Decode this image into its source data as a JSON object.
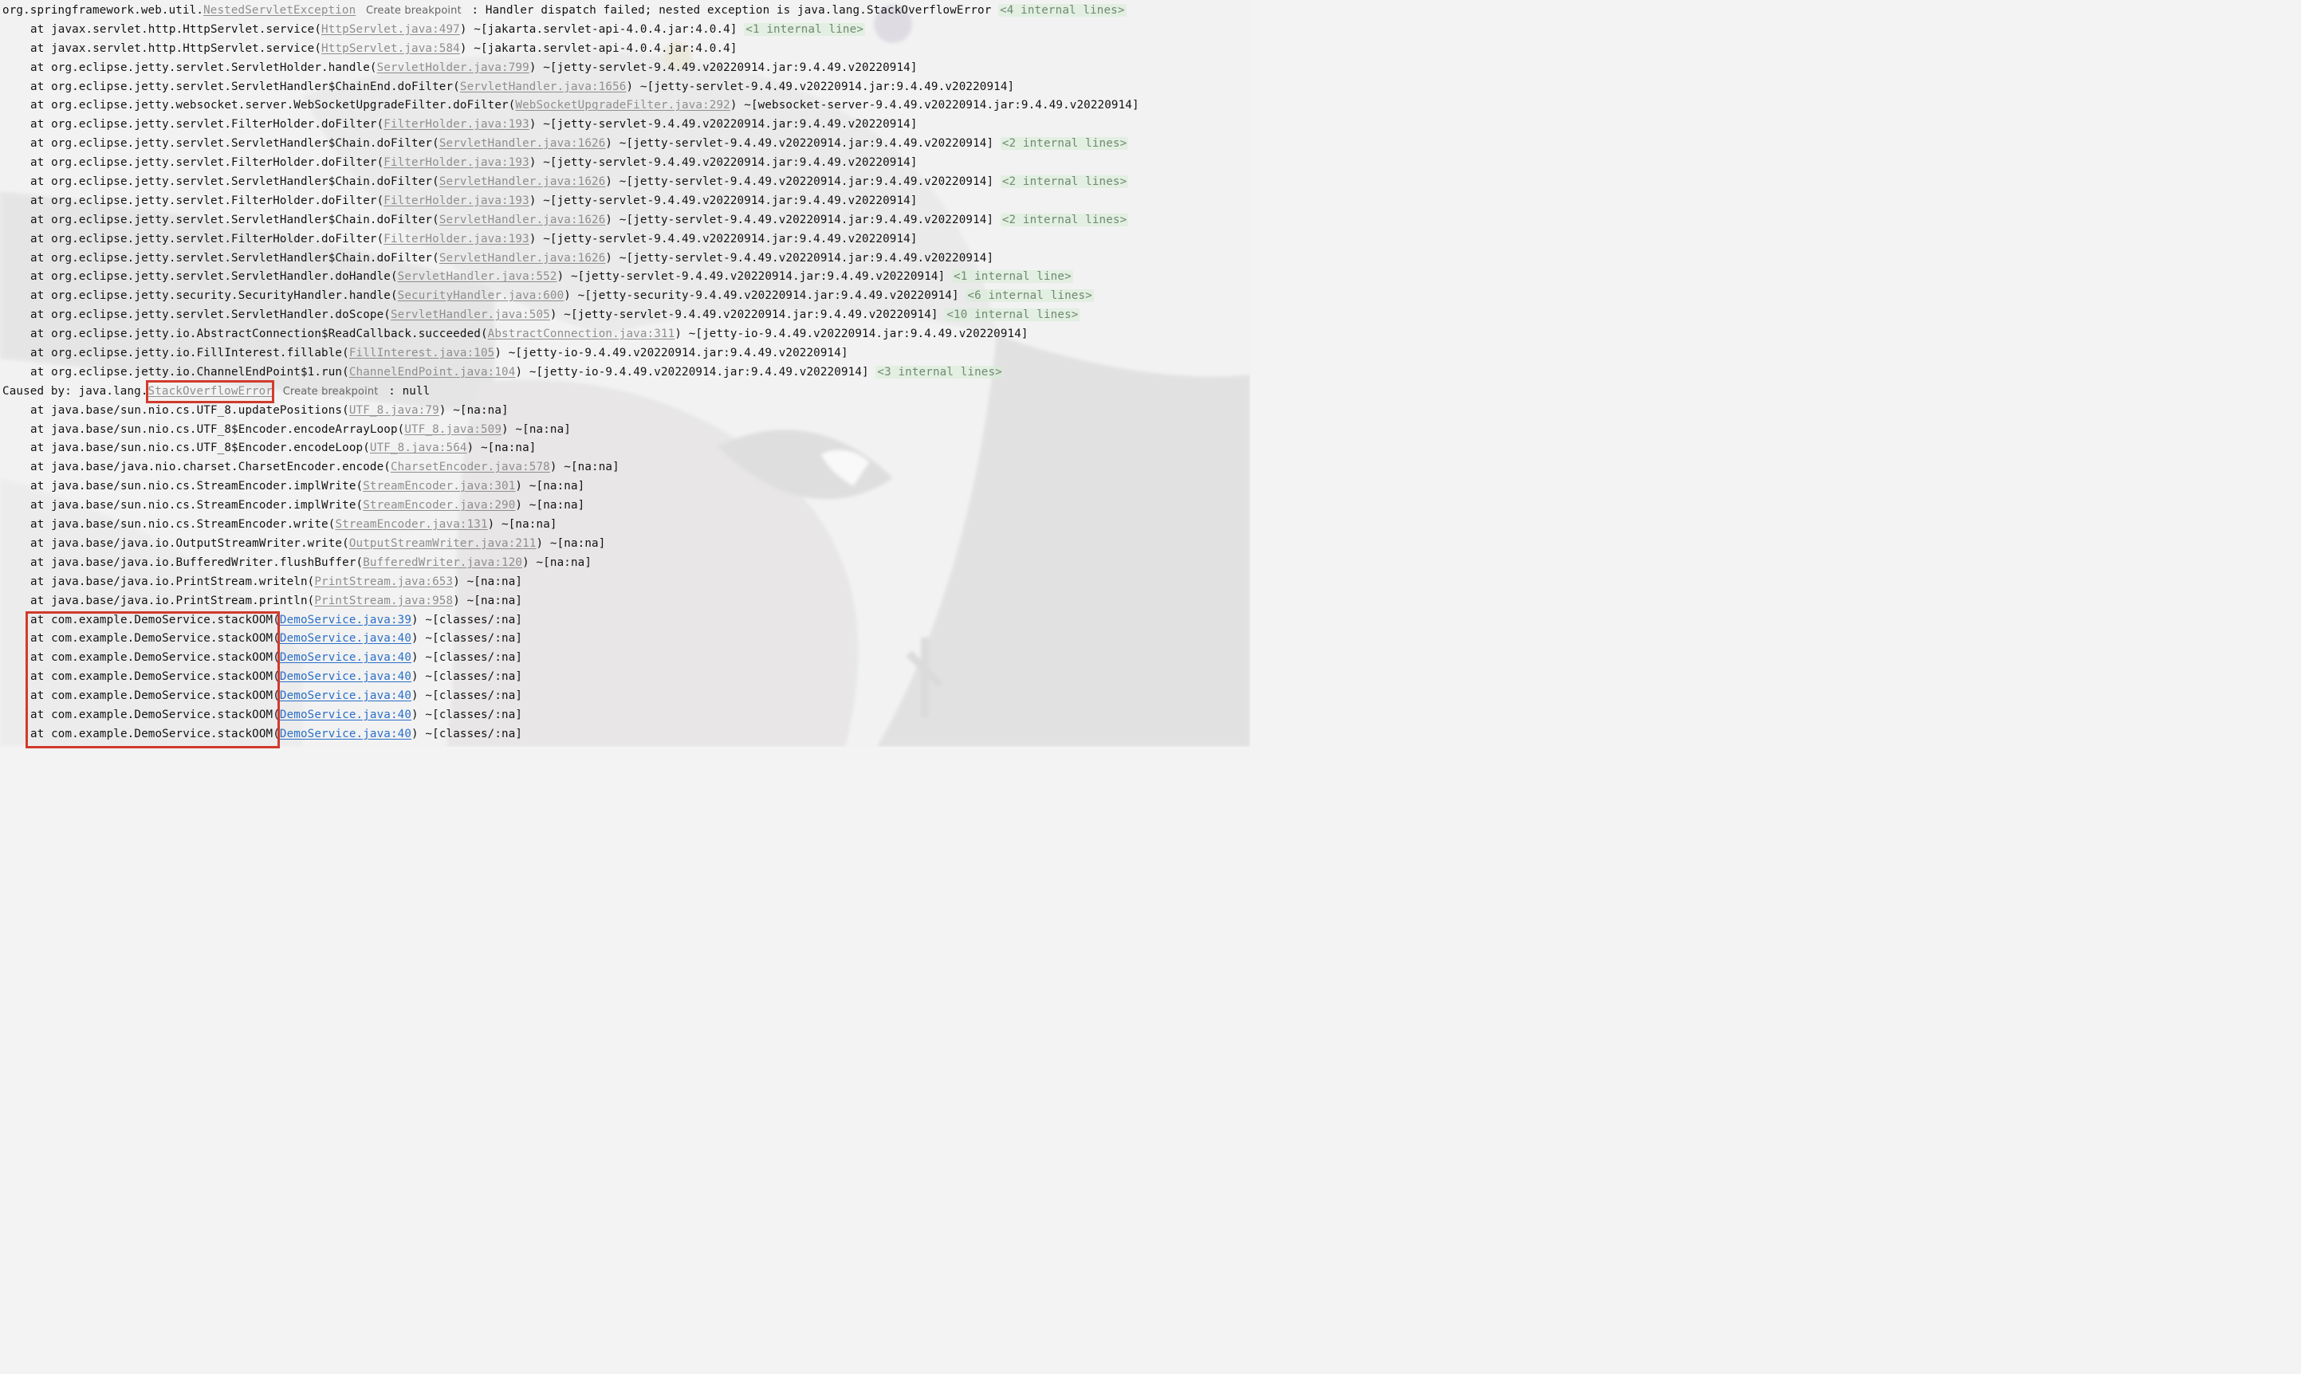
{
  "header": {
    "package": "org.springframework.web.util.",
    "exception_link": "NestedServletException",
    "breakpoint_label": "Create breakpoint",
    "message": " : Handler dispatch failed; nested exception is java.lang.StackOverflowError ",
    "internal": "<4 internal lines>"
  },
  "frames_top": [
    {
      "method": "at javax.servlet.http.HttpServlet.service(",
      "file": "HttpServlet.java:497",
      "jar": ") ~[jakarta.servlet-api-4.0.4.jar:4.0.4] ",
      "internal": "<1 internal line>"
    },
    {
      "method": "at javax.servlet.http.HttpServlet.service(",
      "file": "HttpServlet.java:584",
      "jar": ") ~[jakarta.servlet-api-4.0.4.jar:4.0.4]",
      "internal": ""
    },
    {
      "method": "at org.eclipse.jetty.servlet.ServletHolder.handle(",
      "file": "ServletHolder.java:799",
      "jar": ") ~[jetty-servlet-9.4.49.v20220914.jar:9.4.49.v20220914]",
      "internal": ""
    },
    {
      "method": "at org.eclipse.jetty.servlet.ServletHandler$ChainEnd.doFilter(",
      "file": "ServletHandler.java:1656",
      "jar": ") ~[jetty-servlet-9.4.49.v20220914.jar:9.4.49.v20220914]",
      "internal": ""
    },
    {
      "method": "at org.eclipse.jetty.websocket.server.WebSocketUpgradeFilter.doFilter(",
      "file": "WebSocketUpgradeFilter.java:292",
      "jar": ") ~[websocket-server-9.4.49.v20220914.jar:9.4.49.v20220914]",
      "internal": ""
    },
    {
      "method": "at org.eclipse.jetty.servlet.FilterHolder.doFilter(",
      "file": "FilterHolder.java:193",
      "jar": ") ~[jetty-servlet-9.4.49.v20220914.jar:9.4.49.v20220914]",
      "internal": ""
    },
    {
      "method": "at org.eclipse.jetty.servlet.ServletHandler$Chain.doFilter(",
      "file": "ServletHandler.java:1626",
      "jar": ") ~[jetty-servlet-9.4.49.v20220914.jar:9.4.49.v20220914] ",
      "internal": "<2 internal lines>"
    },
    {
      "method": "at org.eclipse.jetty.servlet.FilterHolder.doFilter(",
      "file": "FilterHolder.java:193",
      "jar": ") ~[jetty-servlet-9.4.49.v20220914.jar:9.4.49.v20220914]",
      "internal": ""
    },
    {
      "method": "at org.eclipse.jetty.servlet.ServletHandler$Chain.doFilter(",
      "file": "ServletHandler.java:1626",
      "jar": ") ~[jetty-servlet-9.4.49.v20220914.jar:9.4.49.v20220914] ",
      "internal": "<2 internal lines>"
    },
    {
      "method": "at org.eclipse.jetty.servlet.FilterHolder.doFilter(",
      "file": "FilterHolder.java:193",
      "jar": ") ~[jetty-servlet-9.4.49.v20220914.jar:9.4.49.v20220914]",
      "internal": ""
    },
    {
      "method": "at org.eclipse.jetty.servlet.ServletHandler$Chain.doFilter(",
      "file": "ServletHandler.java:1626",
      "jar": ") ~[jetty-servlet-9.4.49.v20220914.jar:9.4.49.v20220914] ",
      "internal": "<2 internal lines>"
    },
    {
      "method": "at org.eclipse.jetty.servlet.FilterHolder.doFilter(",
      "file": "FilterHolder.java:193",
      "jar": ") ~[jetty-servlet-9.4.49.v20220914.jar:9.4.49.v20220914]",
      "internal": ""
    },
    {
      "method": "at org.eclipse.jetty.servlet.ServletHandler$Chain.doFilter(",
      "file": "ServletHandler.java:1626",
      "jar": ") ~[jetty-servlet-9.4.49.v20220914.jar:9.4.49.v20220914]",
      "internal": ""
    },
    {
      "method": "at org.eclipse.jetty.servlet.ServletHandler.doHandle(",
      "file": "ServletHandler.java:552",
      "jar": ") ~[jetty-servlet-9.4.49.v20220914.jar:9.4.49.v20220914] ",
      "internal": "<1 internal line>"
    },
    {
      "method": "at org.eclipse.jetty.security.SecurityHandler.handle(",
      "file": "SecurityHandler.java:600",
      "jar": ") ~[jetty-security-9.4.49.v20220914.jar:9.4.49.v20220914] ",
      "internal": "<6 internal lines>"
    },
    {
      "method": "at org.eclipse.jetty.servlet.ServletHandler.doScope(",
      "file": "ServletHandler.java:505",
      "jar": ") ~[jetty-servlet-9.4.49.v20220914.jar:9.4.49.v20220914] ",
      "internal": "<10 internal lines>"
    },
    {
      "method": "at org.eclipse.jetty.io.AbstractConnection$ReadCallback.succeeded(",
      "file": "AbstractConnection.java:311",
      "jar": ") ~[jetty-io-9.4.49.v20220914.jar:9.4.49.v20220914]",
      "internal": ""
    },
    {
      "method": "at org.eclipse.jetty.io.FillInterest.fillable(",
      "file": "FillInterest.java:105",
      "jar": ") ~[jetty-io-9.4.49.v20220914.jar:9.4.49.v20220914]",
      "internal": ""
    },
    {
      "method": "at org.eclipse.jetty.io.ChannelEndPoint$1.run(",
      "file": "ChannelEndPoint.java:104",
      "jar": ") ~[jetty-io-9.4.49.v20220914.jar:9.4.49.v20220914] ",
      "internal": "<3 internal lines>"
    }
  ],
  "caused_by": {
    "prefix": "Caused by: java.lang.",
    "exception_link": "StackOverflowError",
    "breakpoint_label": "Create breakpoint",
    "message": " : null"
  },
  "frames_bottom": [
    {
      "method": "at java.base/sun.nio.cs.UTF_8.updatePositions(",
      "file": "UTF_8.java:79",
      "jar": ") ~[na:na]",
      "user": false
    },
    {
      "method": "at java.base/sun.nio.cs.UTF_8$Encoder.encodeArrayLoop(",
      "file": "UTF_8.java:509",
      "jar": ") ~[na:na]",
      "user": false
    },
    {
      "method": "at java.base/sun.nio.cs.UTF_8$Encoder.encodeLoop(",
      "file": "UTF_8.java:564",
      "jar": ") ~[na:na]",
      "user": false
    },
    {
      "method": "at java.base/java.nio.charset.CharsetEncoder.encode(",
      "file": "CharsetEncoder.java:578",
      "jar": ") ~[na:na]",
      "user": false
    },
    {
      "method": "at java.base/sun.nio.cs.StreamEncoder.implWrite(",
      "file": "StreamEncoder.java:301",
      "jar": ") ~[na:na]",
      "user": false
    },
    {
      "method": "at java.base/sun.nio.cs.StreamEncoder.implWrite(",
      "file": "StreamEncoder.java:290",
      "jar": ") ~[na:na]",
      "user": false
    },
    {
      "method": "at java.base/sun.nio.cs.StreamEncoder.write(",
      "file": "StreamEncoder.java:131",
      "jar": ") ~[na:na]",
      "user": false
    },
    {
      "method": "at java.base/java.io.OutputStreamWriter.write(",
      "file": "OutputStreamWriter.java:211",
      "jar": ") ~[na:na]",
      "user": false
    },
    {
      "method": "at java.base/java.io.BufferedWriter.flushBuffer(",
      "file": "BufferedWriter.java:120",
      "jar": ") ~[na:na]",
      "user": false
    },
    {
      "method": "at java.base/java.io.PrintStream.writeln(",
      "file": "PrintStream.java:653",
      "jar": ") ~[na:na]",
      "user": false
    },
    {
      "method": "at java.base/java.io.PrintStream.println(",
      "file": "PrintStream.java:958",
      "jar": ") ~[na:na]",
      "user": false
    },
    {
      "method": "at com.example.DemoService.stackOOM(",
      "file": "DemoService.java:39",
      "jar": ") ~[classes/:na]",
      "user": true
    },
    {
      "method": "at com.example.DemoService.stackOOM(",
      "file": "DemoService.java:40",
      "jar": ") ~[classes/:na]",
      "user": true
    },
    {
      "method": "at com.example.DemoService.stackOOM(",
      "file": "DemoService.java:40",
      "jar": ") ~[classes/:na]",
      "user": true
    },
    {
      "method": "at com.example.DemoService.stackOOM(",
      "file": "DemoService.java:40",
      "jar": ") ~[classes/:na]",
      "user": true
    },
    {
      "method": "at com.example.DemoService.stackOOM(",
      "file": "DemoService.java:40",
      "jar": ") ~[classes/:na]",
      "user": true
    },
    {
      "method": "at com.example.DemoService.stackOOM(",
      "file": "DemoService.java:40",
      "jar": ") ~[classes/:na]",
      "user": true
    },
    {
      "method": "at com.example.DemoService.stackOOM(",
      "file": "DemoService.java:40",
      "jar": ") ~[classes/:na]",
      "user": true
    }
  ],
  "colors": {
    "link_library": "#8e8e8e",
    "link_user": "#2a6fc9",
    "internal_lines": "#6f8a6f",
    "highlight_box": "#d03b2c",
    "background": "#f3f3f3"
  }
}
